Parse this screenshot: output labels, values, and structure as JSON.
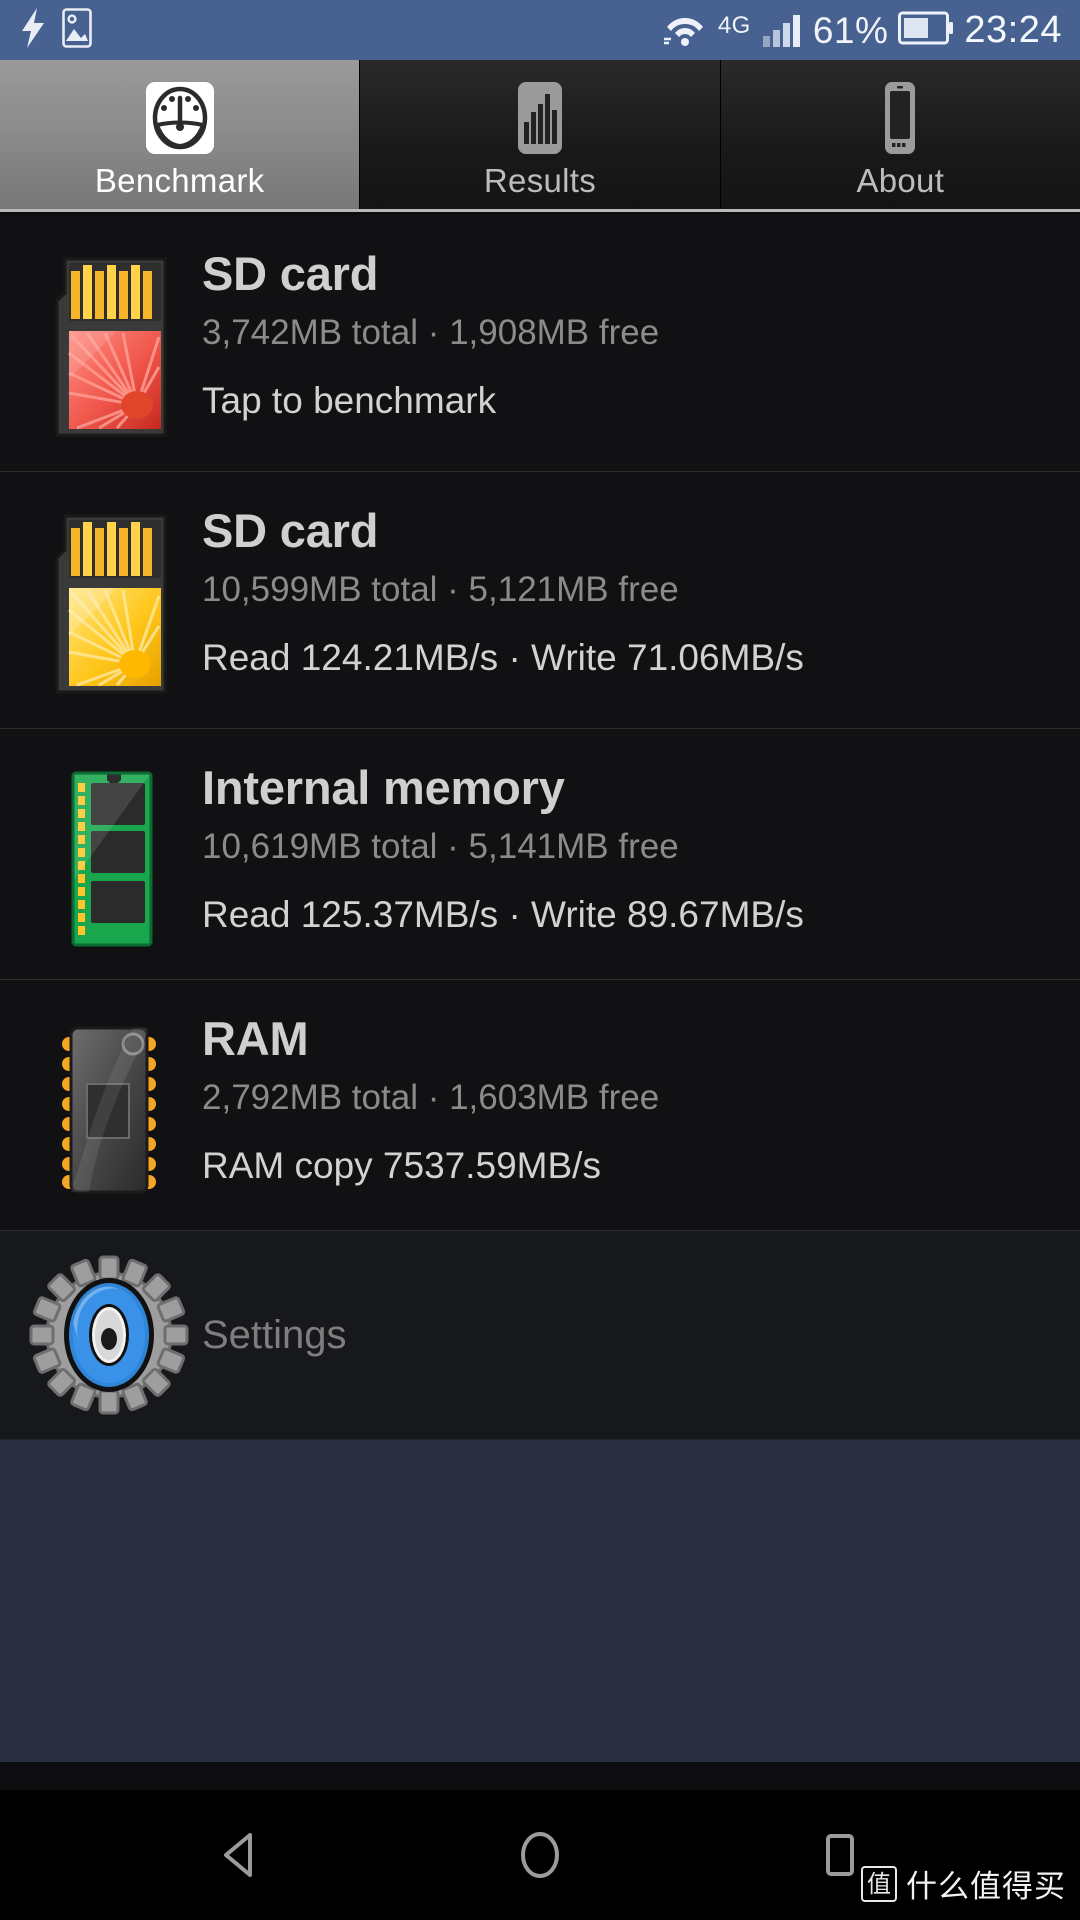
{
  "status_bar": {
    "background": "#476190",
    "icons": [
      "charging-bolt-icon",
      "screenshot-icon",
      "wifi-icon",
      "signal-icon"
    ],
    "network_type": "4G",
    "battery_percent": "61%",
    "time": "23:24"
  },
  "tabs": [
    {
      "label": "Benchmark",
      "icon": "speedometer-icon",
      "active": true
    },
    {
      "label": "Results",
      "icon": "bar-chart-icon",
      "active": false
    },
    {
      "label": "About",
      "icon": "phone-icon",
      "active": false
    }
  ],
  "rows": [
    {
      "title": "SD card",
      "capacity": "3,742MB total · 1,908MB free",
      "result": "Tap to benchmark",
      "icon": "sd-card-red-icon"
    },
    {
      "title": "SD card",
      "capacity": "10,599MB total · 5,121MB free",
      "result": "Read 124.21MB/s · Write 71.06MB/s",
      "icon": "sd-card-yellow-icon"
    },
    {
      "title": "Internal memory",
      "capacity": "10,619MB total · 5,141MB free",
      "result": "Read 125.37MB/s · Write 89.67MB/s",
      "icon": "memory-module-green-icon"
    },
    {
      "title": "RAM",
      "capacity": "2,792MB total · 1,603MB free",
      "result": "RAM copy 7537.59MB/s",
      "icon": "ram-chip-icon"
    }
  ],
  "settings": {
    "label": "Settings",
    "icon": "gear-eye-icon"
  },
  "nav_bar": {
    "back": "back-triangle-icon",
    "home": "home-circle-icon",
    "recents": "recents-square-icon"
  },
  "watermark": {
    "logo": "值",
    "text": "什么值得买"
  },
  "colors": {
    "status_bar_blue": "#476190",
    "active_tab_gray": "#8c8c8c",
    "list_background": "#111113",
    "filler_background": "#2b3040",
    "title_text": "#cfcfcf",
    "sub_text": "#8b8b8b",
    "result_text": "#d2d2d2"
  }
}
